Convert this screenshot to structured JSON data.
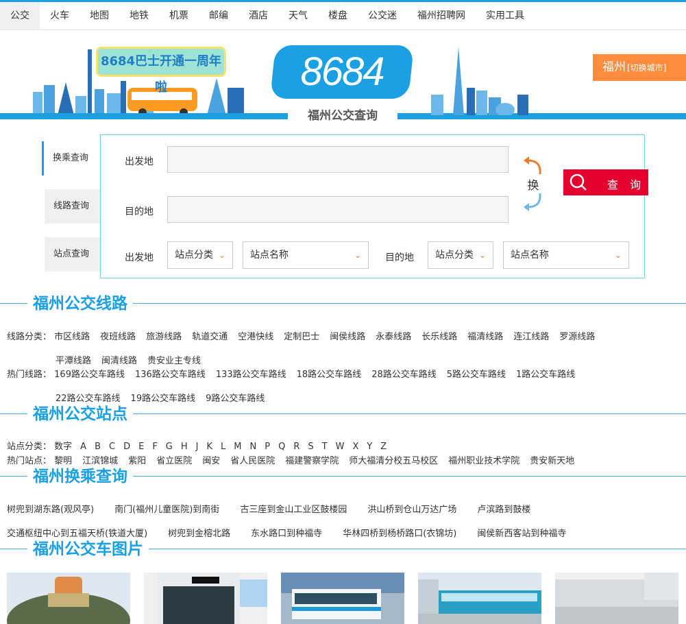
{
  "nav": [
    "公交",
    "火车",
    "地图",
    "地铁",
    "机票",
    "邮编",
    "酒店",
    "天气",
    "楼盘",
    "公交迷",
    "福州招聘网",
    "实用工具"
  ],
  "banner": {
    "logo": "8684",
    "subtitle": "福州公交查询",
    "anniversary": "8684巴士开通一周年啦",
    "city": "福州",
    "switch_city": "[切换城市]"
  },
  "tabs": [
    "换乘查询",
    "线路查询",
    "站点查询"
  ],
  "search": {
    "from_label": "出发地",
    "to_label": "目的地",
    "swap": "换",
    "button": "查 询",
    "station_from_label": "出发地",
    "station_to_label": "目的地",
    "station_category": "站点分类",
    "station_name": "站点名称"
  },
  "sections": {
    "lines": "福州公交线路",
    "stations": "福州公交站点",
    "transfer": "福州换乘查询",
    "photos": "福州公交车图片"
  },
  "lines": {
    "category_label": "线路分类：",
    "categories_row1": [
      "市区线路",
      "夜班线路",
      "旅游线路",
      "轨道交通",
      "空港快线",
      "定制巴士",
      "闽侯线路",
      "永泰线路",
      "长乐线路",
      "福清线路",
      "连江线路",
      "罗源线路"
    ],
    "categories_row2": [
      "平潭线路",
      "闽清线路",
      "贵安业主专线"
    ],
    "hot_label": "热门线路：",
    "hot_row1": [
      "169路公交车路线",
      "136路公交车路线",
      "133路公交车路线",
      "18路公交车路线",
      "28路公交车路线",
      "5路公交车路线",
      "1路公交车路线"
    ],
    "hot_row2": [
      "22路公交车路线",
      "19路公交车路线",
      "9路公交车路线"
    ]
  },
  "stations": {
    "category_label": "站点分类：",
    "letters": [
      "数字",
      "A",
      "B",
      "C",
      "D",
      "E",
      "F",
      "G",
      "H",
      "J",
      "K",
      "L",
      "M",
      "N",
      "P",
      "Q",
      "R",
      "S",
      "T",
      "W",
      "X",
      "Y",
      "Z"
    ],
    "hot_label": "热门站点：",
    "hot": [
      "黎明",
      "江滨锦城",
      "紫阳",
      "省立医院",
      "闽安",
      "省人民医院",
      "福建警察学院",
      "师大福清分校五马校区",
      "福州职业技术学院",
      "贵安新天地"
    ]
  },
  "transfer": {
    "row1": [
      "树兜到湖东路(观风亭)",
      "南门(福州儿童医院)到南街",
      "古三座到金山工业区鼓楼园",
      "洪山桥到仓山万达广场",
      "卢滨路到鼓楼"
    ],
    "row2": [
      "交通枢纽中心到五福天桥(铁道大厦)",
      "树兜到金榕北路",
      "东水路口到种福寺",
      "华林四桥到杨桥路口(衣锦坊)",
      "闽侯新西客站到种福寺"
    ]
  },
  "colors": {
    "accent": "#1aa0e3",
    "city_button": "#ff8b3d",
    "search_button": "#e5012d",
    "arrow": "#f07d2e"
  }
}
